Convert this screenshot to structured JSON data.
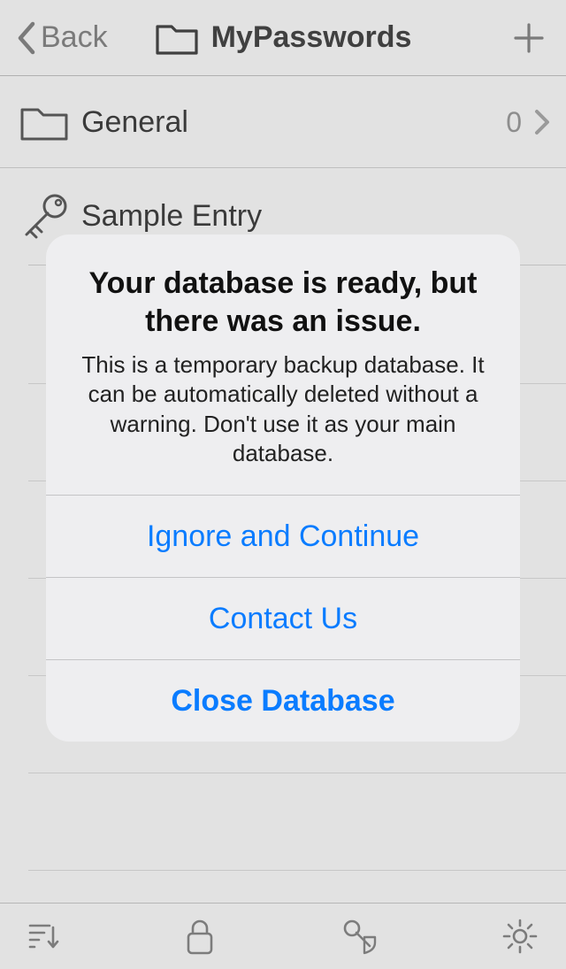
{
  "nav": {
    "back_label": "Back",
    "title": "MyPasswords"
  },
  "list": {
    "folder": {
      "label": "General",
      "count": "0"
    },
    "entry": {
      "label": "Sample Entry",
      "sub": ""
    }
  },
  "alert": {
    "title": "Your database is ready, but there was an issue.",
    "message": "This is a temporary backup database. It can be automatically deleted without a warning. Don't use it as your main database.",
    "btn_ignore": "Ignore and Continue",
    "btn_contact": "Contact Us",
    "btn_close": "Close Database"
  },
  "colors": {
    "link": "#0a7cff"
  }
}
